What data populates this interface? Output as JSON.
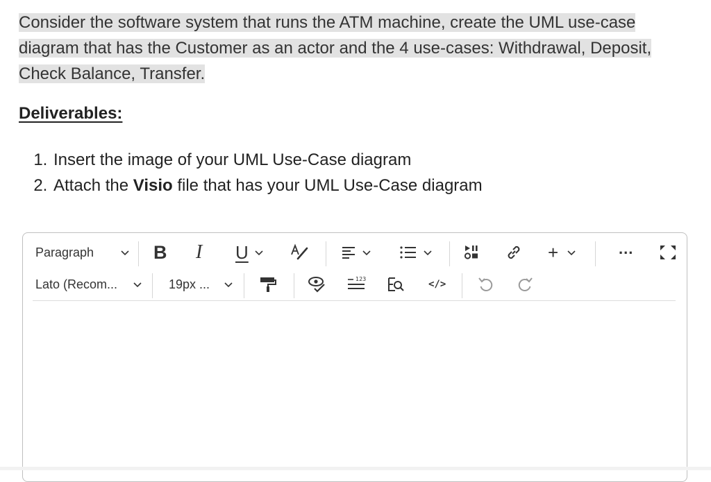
{
  "prompt": {
    "text": "Consider the software system that runs the ATM machine, create the UML use-case diagram that has the Customer as an actor and the 4 use-cases: Withdrawal, Deposit, Check Balance, Transfer."
  },
  "deliverables": {
    "heading": "Deliverables:",
    "items": [
      {
        "prefix": "Insert the image of your UML Use-Case diagram",
        "bold": "",
        "suffix": ""
      },
      {
        "prefix": "Attach the ",
        "bold": "Visio",
        "suffix": " file that has your UML Use-Case diagram"
      }
    ]
  },
  "editor": {
    "toolbar": {
      "paragraph_label": "Paragraph",
      "font_label": "Lato (Recom...",
      "size_label": "19px ...",
      "bold_glyph": "B",
      "italic_glyph": "I",
      "underline_glyph": "U",
      "code_glyph": "</>",
      "insert_glyph": "+",
      "more_glyph": "..."
    },
    "content": ""
  }
}
